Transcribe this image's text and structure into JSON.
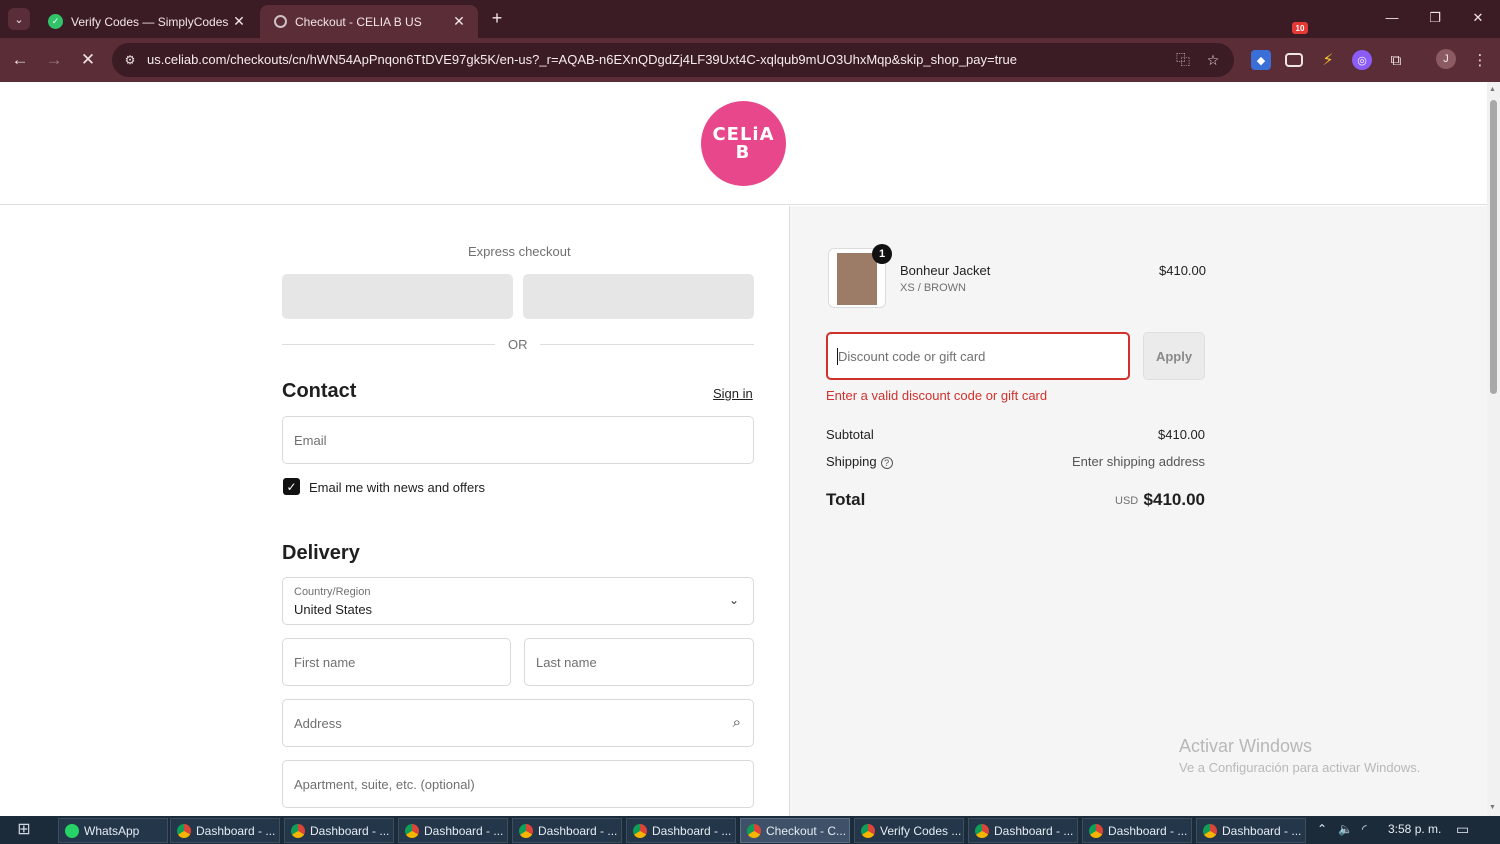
{
  "browser": {
    "tabs": [
      {
        "title": "Verify Codes — SimplyCodes",
        "active": false
      },
      {
        "title": "Checkout - CELIA B US",
        "active": true
      }
    ],
    "url": "us.celiab.com/checkouts/cn/hWN54ApPnqon6TtDVE97gk5K/en-us?_r=AQAB-n6EXnQDgdZj4LF39Uxt4C-xqlqub9mUO3UhxMqp&skip_shop_pay=true",
    "extension_badge": "10",
    "profile_initial": "J"
  },
  "brand": {
    "logo_line1": "CELiA",
    "logo_line2": "B"
  },
  "checkout": {
    "express_label": "Express checkout",
    "or_label": "OR",
    "contact": {
      "heading": "Contact",
      "sign_in": "Sign in",
      "email_placeholder": "Email",
      "newsletter_label": "Email me with news and offers",
      "newsletter_checked": true
    },
    "delivery": {
      "heading": "Delivery",
      "country_label": "Country/Region",
      "country_value": "United States",
      "first_name_placeholder": "First name",
      "last_name_placeholder": "Last name",
      "address_placeholder": "Address",
      "apartment_placeholder": "Apartment, suite, etc. (optional)"
    }
  },
  "order_summary": {
    "item": {
      "quantity": "1",
      "name": "Bonheur Jacket",
      "variant": "XS / BROWN",
      "price": "$410.00"
    },
    "discount_placeholder": "Discount code or gift card",
    "apply_label": "Apply",
    "error": "Enter a valid discount code or gift card",
    "subtotal_label": "Subtotal",
    "subtotal_value": "$410.00",
    "shipping_label": "Shipping",
    "shipping_value": "Enter shipping address",
    "total_label": "Total",
    "total_currency": "USD",
    "total_value": "$410.00"
  },
  "watermark": {
    "title": "Activar Windows",
    "subtitle": "Ve a Configuración para activar Windows."
  },
  "taskbar": {
    "items": [
      {
        "label": "WhatsApp",
        "icon": "whatsapp-icon"
      },
      {
        "label": "Dashboard - ...",
        "icon": "chrome-icon"
      },
      {
        "label": "Dashboard - ...",
        "icon": "chrome-icon"
      },
      {
        "label": "Dashboard - ...",
        "icon": "chrome-icon"
      },
      {
        "label": "Dashboard - ...",
        "icon": "chrome-icon"
      },
      {
        "label": "Dashboard - ...",
        "icon": "chrome-icon"
      },
      {
        "label": "Checkout - C...",
        "icon": "chrome-icon",
        "active": true
      },
      {
        "label": "Verify Codes ...",
        "icon": "chrome-icon"
      },
      {
        "label": "Dashboard - ...",
        "icon": "chrome-icon"
      },
      {
        "label": "Dashboard - ...",
        "icon": "chrome-icon"
      },
      {
        "label": "Dashboard - ...",
        "icon": "chrome-icon"
      }
    ],
    "clock": "3:58 p. m."
  },
  "colors": {
    "brand_pink": "#e8478b",
    "error_red": "#d0312d",
    "chrome_frame": "#3c1c24",
    "chrome_toolbar": "#5b2d37"
  }
}
